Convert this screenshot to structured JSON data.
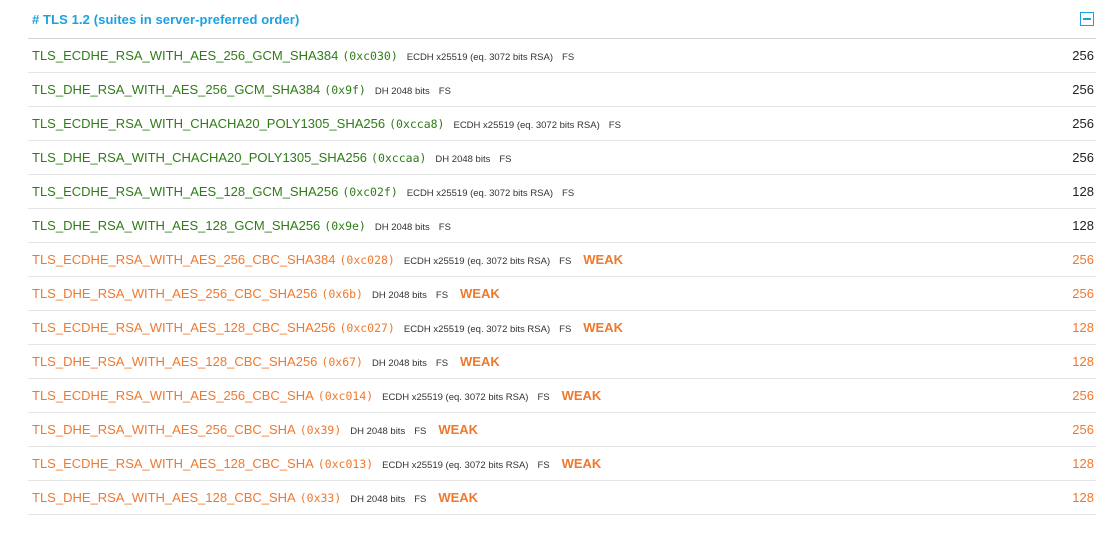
{
  "header": {
    "title": "# TLS 1.2 (suites in server-preferred order)"
  },
  "colors": {
    "strong": "#2e7d14",
    "weak": "#f0782d",
    "header": "#1ba1e2"
  },
  "suites": [
    {
      "name": "TLS_ECDHE_RSA_WITH_AES_256_GCM_SHA384",
      "code": "(0xc030)",
      "details": "ECDH x25519 (eq. 3072 bits RSA)",
      "fs": "FS",
      "weak": "",
      "bits": "256",
      "status": "strong"
    },
    {
      "name": "TLS_DHE_RSA_WITH_AES_256_GCM_SHA384",
      "code": "(0x9f)",
      "details": "DH 2048 bits",
      "fs": "FS",
      "weak": "",
      "bits": "256",
      "status": "strong"
    },
    {
      "name": "TLS_ECDHE_RSA_WITH_CHACHA20_POLY1305_SHA256",
      "code": "(0xcca8)",
      "details": "ECDH x25519 (eq. 3072 bits RSA)",
      "fs": "FS",
      "weak": "",
      "bits": "256",
      "status": "strong"
    },
    {
      "name": "TLS_DHE_RSA_WITH_CHACHA20_POLY1305_SHA256",
      "code": "(0xccaa)",
      "details": "DH 2048 bits",
      "fs": "FS",
      "weak": "",
      "bits": "256",
      "status": "strong"
    },
    {
      "name": "TLS_ECDHE_RSA_WITH_AES_128_GCM_SHA256",
      "code": "(0xc02f)",
      "details": "ECDH x25519 (eq. 3072 bits RSA)",
      "fs": "FS",
      "weak": "",
      "bits": "128",
      "status": "strong"
    },
    {
      "name": "TLS_DHE_RSA_WITH_AES_128_GCM_SHA256",
      "code": "(0x9e)",
      "details": "DH 2048 bits",
      "fs": "FS",
      "weak": "",
      "bits": "128",
      "status": "strong"
    },
    {
      "name": "TLS_ECDHE_RSA_WITH_AES_256_CBC_SHA384",
      "code": "(0xc028)",
      "details": "ECDH x25519 (eq. 3072 bits RSA)",
      "fs": "FS",
      "weak": "WEAK",
      "bits": "256",
      "status": "weak"
    },
    {
      "name": "TLS_DHE_RSA_WITH_AES_256_CBC_SHA256",
      "code": "(0x6b)",
      "details": "DH 2048 bits",
      "fs": "FS",
      "weak": "WEAK",
      "bits": "256",
      "status": "weak"
    },
    {
      "name": "TLS_ECDHE_RSA_WITH_AES_128_CBC_SHA256",
      "code": "(0xc027)",
      "details": "ECDH x25519 (eq. 3072 bits RSA)",
      "fs": "FS",
      "weak": "WEAK",
      "bits": "128",
      "status": "weak"
    },
    {
      "name": "TLS_DHE_RSA_WITH_AES_128_CBC_SHA256",
      "code": "(0x67)",
      "details": "DH 2048 bits",
      "fs": "FS",
      "weak": "WEAK",
      "bits": "128",
      "status": "weak"
    },
    {
      "name": "TLS_ECDHE_RSA_WITH_AES_256_CBC_SHA",
      "code": "(0xc014)",
      "details": "ECDH x25519 (eq. 3072 bits RSA)",
      "fs": "FS",
      "weak": "WEAK",
      "bits": "256",
      "status": "weak"
    },
    {
      "name": "TLS_DHE_RSA_WITH_AES_256_CBC_SHA",
      "code": "(0x39)",
      "details": "DH 2048 bits",
      "fs": "FS",
      "weak": "WEAK",
      "bits": "256",
      "status": "weak"
    },
    {
      "name": "TLS_ECDHE_RSA_WITH_AES_128_CBC_SHA",
      "code": "(0xc013)",
      "details": "ECDH x25519 (eq. 3072 bits RSA)",
      "fs": "FS",
      "weak": "WEAK",
      "bits": "128",
      "status": "weak"
    },
    {
      "name": "TLS_DHE_RSA_WITH_AES_128_CBC_SHA",
      "code": "(0x33)",
      "details": "DH 2048 bits",
      "fs": "FS",
      "weak": "WEAK",
      "bits": "128",
      "status": "weak"
    }
  ]
}
